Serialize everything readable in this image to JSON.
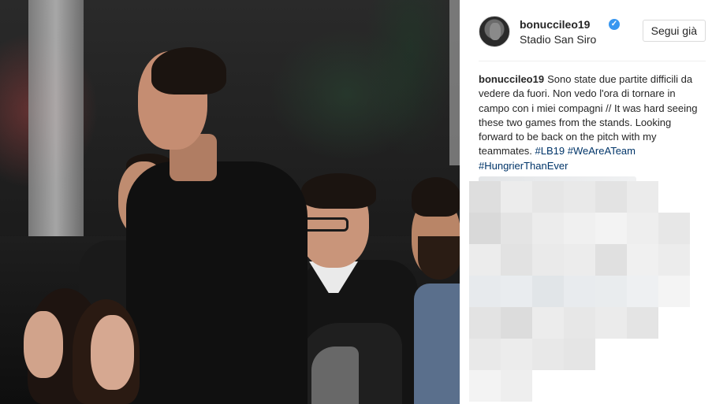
{
  "post": {
    "username": "bonucci leo19",
    "username_text": "bonucci leo19",
    "location": "Stadio San Siro",
    "follow_label": "Segui già",
    "verified_icon": "verified-badge-icon",
    "caption": {
      "username": "bonucci leo19",
      "text": "Sono state due partite difficili da vedere da fuori. Non vedo l'ora di tornare in campo con i miei compagni // It was hard seeing these two games from the stands. Looking forward to be back on the pitch with my teammates.",
      "hashtags": [
        "#LB19",
        "#WeAreATeam",
        "#HungrierThanEver"
      ]
    }
  },
  "colors": {
    "link": "#003569",
    "verified": "#3897f0",
    "border": "#dbdbdb"
  },
  "mosaic_tiles": [
    "#dedede",
    "#ececec",
    "#e6e6e6",
    "#e9e9e9",
    "#e3e3e3",
    "#ebebeb",
    "#ffffff",
    "#d9d9d9",
    "#e4e4e4",
    "#ececec",
    "#f0f0f0",
    "#f3f3f3",
    "#eeeeee",
    "#e7e7e7",
    "#ececec",
    "#e2e2e2",
    "#eaeaea",
    "#ececec",
    "#e0e0e0",
    "#f0f0f0",
    "#ececec",
    "#e7eaed",
    "#e9ecef",
    "#e1e5e8",
    "#e8ebee",
    "#e9ecee",
    "#eef0f2",
    "#f4f4f4",
    "#e3e3e3",
    "#dcdcdc",
    "#ececec",
    "#e7e7e7",
    "#ebebeb",
    "#e4e4e4",
    "#ffffff",
    "#e9e9e9",
    "#ececec",
    "#e8e8e8",
    "#e5e5e5",
    "#ffffff",
    "#ffffff",
    "#ffffff",
    "#f3f3f3",
    "#eeeeee",
    "#ffffff",
    "#ffffff",
    "#ffffff",
    "#ffffff",
    "#ffffff"
  ]
}
